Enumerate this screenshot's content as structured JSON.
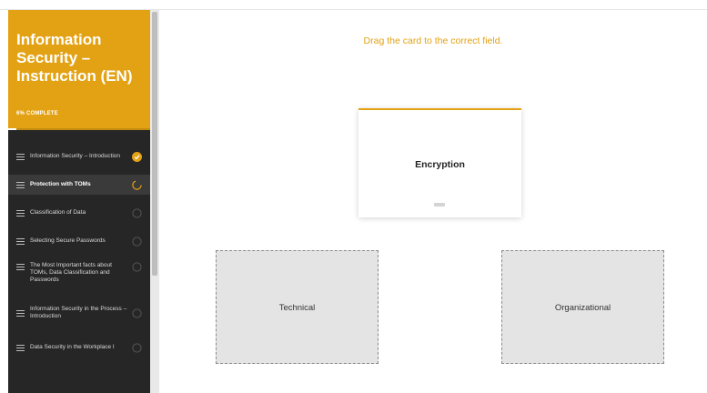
{
  "course": {
    "title": "Information Security – Instruction (EN)",
    "progress_label": "6% COMPLETE",
    "progress": 0.06
  },
  "lessons": [
    {
      "label": "Information Security – Introduction",
      "status": "complete"
    },
    {
      "label": "Protection with TOMs",
      "status": "in-progress",
      "active": true
    },
    {
      "label": "Classification of Data",
      "status": "incomplete"
    },
    {
      "label": "Selecting Secure Passwords",
      "status": "incomplete"
    },
    {
      "label": "The Most Important facts about TOMs, Data Classification and Passwords",
      "status": "incomplete"
    },
    {
      "label": "Information Security in the Process – Introduction",
      "status": "incomplete"
    },
    {
      "label": "Data Security in the Workplace I",
      "status": "incomplete"
    }
  ],
  "main": {
    "instruction": "Drag the card to the correct field.",
    "card_label": "Encryption",
    "zones": [
      "Technical",
      "Organizational"
    ]
  },
  "colors": {
    "accent": "#e3a214",
    "sidebar_bg": "#262626",
    "zone_bg": "#e4e4e4"
  }
}
